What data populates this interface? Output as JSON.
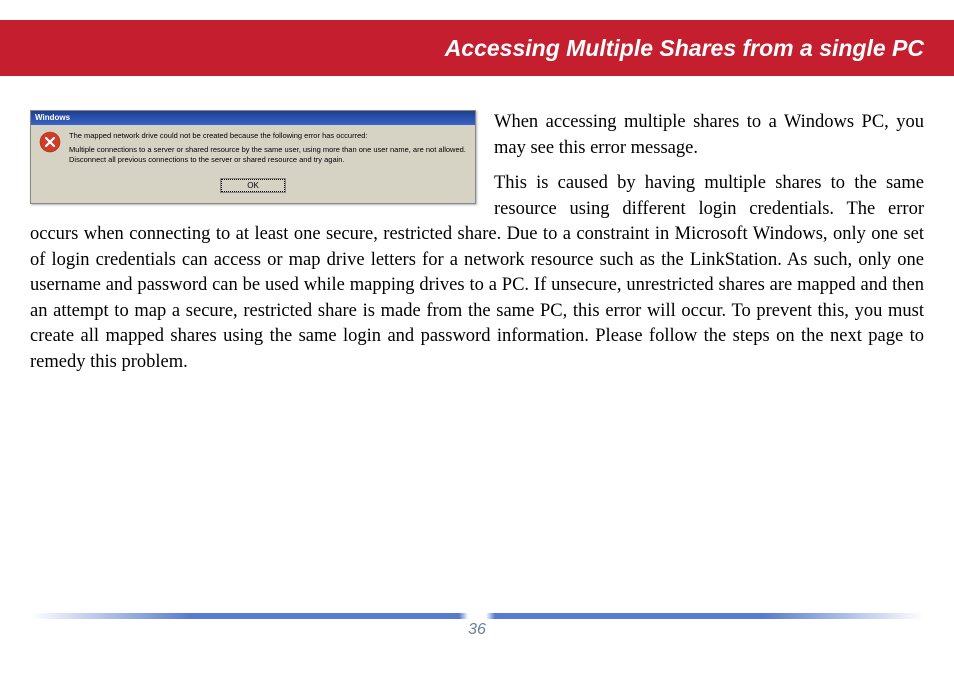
{
  "header": {
    "title": "Accessing Multiple Shares from a single PC"
  },
  "dialog": {
    "titlebar": "Windows",
    "line1": "The mapped network drive could not be created because the following error has occurred:",
    "line2": "Multiple connections to a server or shared resource by the same user, using more than one user name, are not allowed. Disconnect all previous connections to the server or shared resource and try again.",
    "ok_label": "OK"
  },
  "body": {
    "p1": "When accessing multiple shares to a Windows PC, you may see this error message.",
    "p2_lead": "This is caused by having multiple shares to the same resource using different login credentials.",
    "p2_rest": "The error occurs when connecting to at least one secure, restricted share.  Due to a constraint in Microsoft Windows, only one set of login credentials can access or map drive letters for a network resource such as the LinkStation.  As such, only one username and password can be used while mapping drives to a PC.  If unsecure, unrestricted shares are mapped and then an attempt to map a secure, restricted share is made from the same PC, this error will occur.  To prevent this, you must create all mapped shares using the same login and password information.  Please follow the steps on the next page to remedy this problem."
  },
  "footer": {
    "page_number": "36"
  }
}
